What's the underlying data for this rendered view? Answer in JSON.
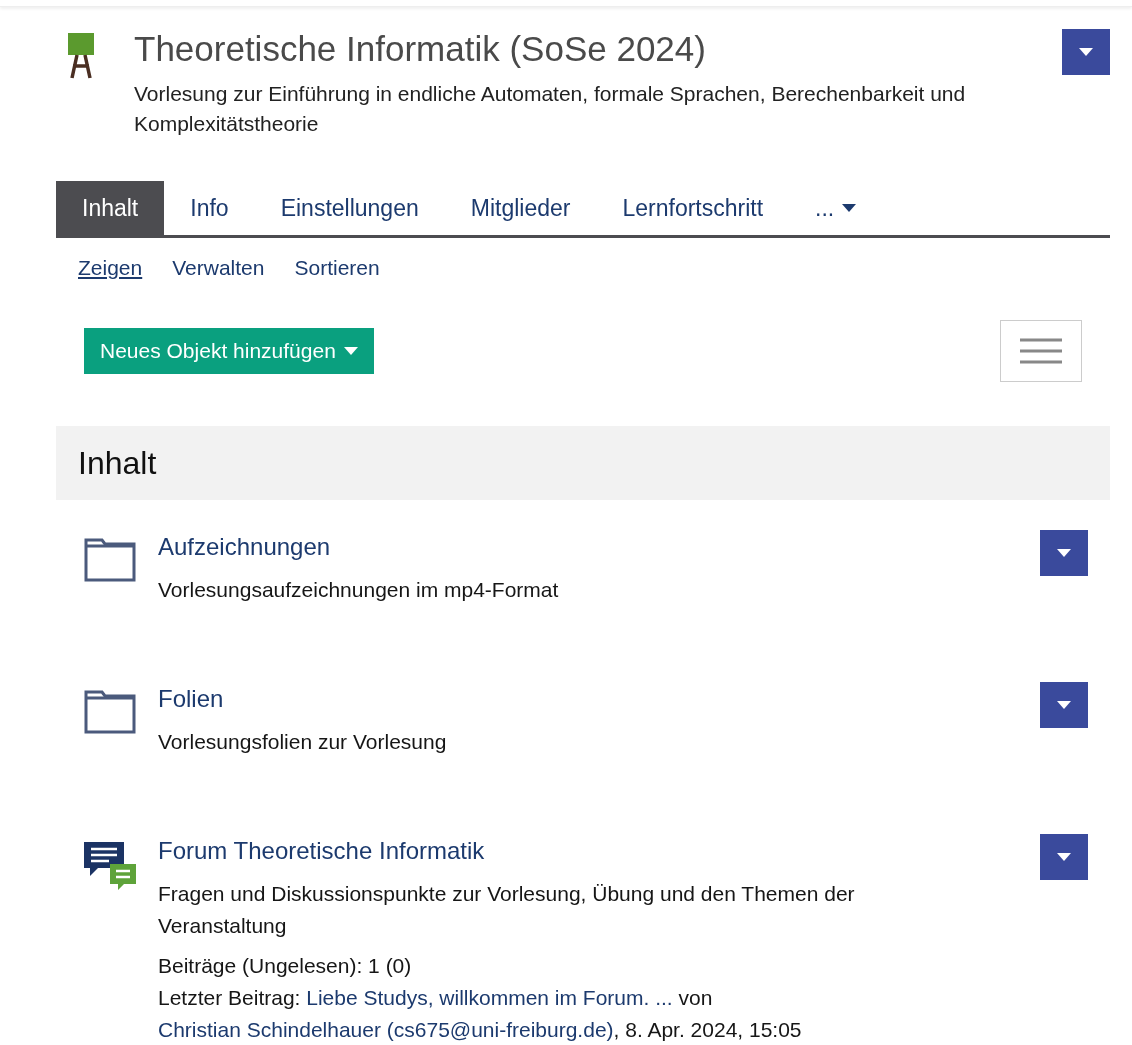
{
  "header": {
    "title": "Theoretische Informatik (SoSe 2024)",
    "description": "Vorlesung zur Einführung in endliche Automaten, formale Sprachen, Berechenbarkeit und Komplexitätstheorie"
  },
  "tabs": [
    {
      "label": "Inhalt",
      "selected": true
    },
    {
      "label": "Info",
      "selected": false
    },
    {
      "label": "Einstellungen",
      "selected": false
    },
    {
      "label": "Mitglieder",
      "selected": false
    },
    {
      "label": "Lernfortschritt",
      "selected": false
    },
    {
      "label": "...",
      "selected": false
    }
  ],
  "subtabs": [
    {
      "label": "Zeigen",
      "selected": true
    },
    {
      "label": "Verwalten",
      "selected": false
    },
    {
      "label": "Sortieren",
      "selected": false
    }
  ],
  "add_button": "Neues Objekt hinzufügen",
  "section": {
    "title": "Inhalt"
  },
  "items": [
    {
      "kind": "folder",
      "title": "Aufzeichnungen",
      "description": "Vorlesungsaufzeichnungen im mp4-Format"
    },
    {
      "kind": "folder",
      "title": "Folien",
      "description": "Vorlesungsfolien zur Vorlesung"
    },
    {
      "kind": "forum",
      "title": "Forum Theoretische Informatik",
      "description": "Fragen und Diskussionspunkte zur Vorlesung, Übung und den Themen der Veranstaltung",
      "posts": "Beiträge (Ungelesen): 1 (0)",
      "last_post": {
        "label": "Letzter Beitrag:",
        "link": "Liebe Studys,  willkommen im Forum. ...",
        "by": "von",
        "author": "Christian Schindelhauer (cs675@uni-freiburg.de)",
        "date": ", 8. Apr. 2024, 15:05"
      }
    }
  ]
}
